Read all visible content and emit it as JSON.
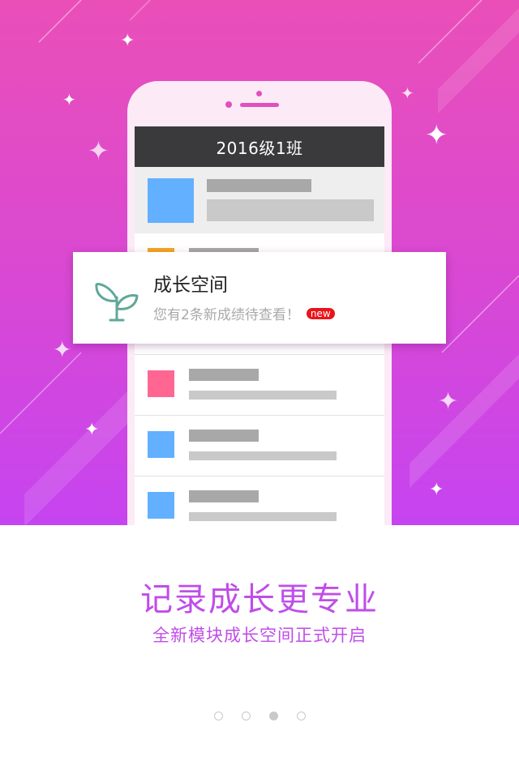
{
  "phone": {
    "screen_title": "2016级1班"
  },
  "notification": {
    "title": "成长空间",
    "message": "您有2条新成绩待查看！",
    "badge": "new",
    "icon": "sprout-icon"
  },
  "intro": {
    "headline": "记录成长更专业",
    "subtitle": "全新模块成长空间正式开启"
  },
  "pager": {
    "total": 4,
    "active_index": 2
  },
  "colors": {
    "gradient_top": "#ea4fb8",
    "gradient_bottom": "#c644f0",
    "accent_text": "#c04de8",
    "badge_red": "#e8151b",
    "icon_teal": "#5fa89a",
    "thumb_blue": "#62b0ff",
    "thumb_pink": "#ff6692",
    "thumb_orange": "#f5a623"
  }
}
